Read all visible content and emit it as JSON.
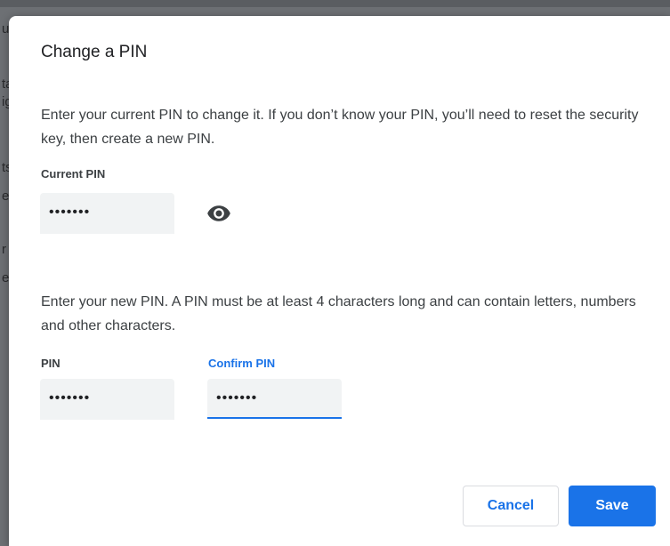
{
  "dialog": {
    "title": "Change a PIN",
    "current_description": "Enter your current PIN to change it. If you don’t know your PIN, you’ll need to reset the security key, then create a new PIN.",
    "current_pin": {
      "label": "Current PIN",
      "value": "1234567",
      "visibility_icon": "eye-icon"
    },
    "new_description": "Enter your new PIN. A PIN must be at least 4 characters long and can contain letters, numbers and other characters.",
    "pin": {
      "label": "PIN",
      "value": "1234567"
    },
    "confirm_pin": {
      "label": "Confirm PIN",
      "value": "1234567"
    },
    "buttons": {
      "cancel_label": "Cancel",
      "save_label": "Save"
    }
  },
  "background_fragments": [
    "u",
    "ta",
    "ig",
    "ts",
    "e",
    "r",
    "e"
  ],
  "colors": {
    "accent": "#1a73e8",
    "field_background": "#f1f3f4",
    "overlay": "#5f6368"
  }
}
